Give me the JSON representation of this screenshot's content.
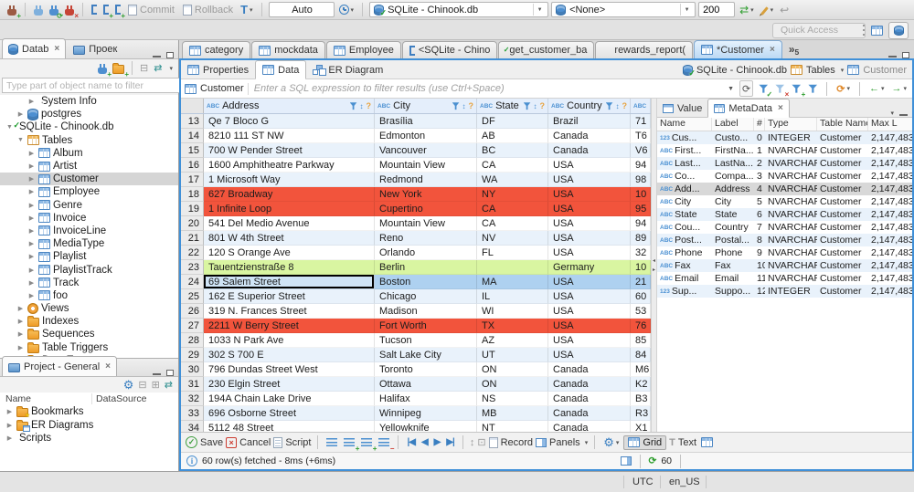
{
  "icons": {
    "caret": "▾",
    "dropdown": "▼",
    "close": "×",
    "check": "✓",
    "cross": "×",
    "refresh": "⟳",
    "gear": "⚙",
    "link": "⇄",
    "collapse": "⊟",
    "expand": "⊞",
    "plus": "+",
    "minus": "−",
    "back": "←",
    "forward": "→",
    "undo": "↩",
    "nav_first": "|◀",
    "nav_prev": "◀",
    "nav_next": "▶",
    "nav_last": "▶|",
    "overflow": "»",
    "info": "i",
    "sash_left": "◂",
    "sash_right": "▸",
    "tree_collapsed": "▶",
    "tree_expanded": "▼",
    "sort": "↕",
    "filter_help": "?",
    "txn": "T",
    "text_mode": "T",
    "type_string": "ABC",
    "type_int": "123",
    "swap": "↕",
    "preview": "⊡"
  },
  "toolbar": {
    "commit": "Commit",
    "rollback": "Rollback",
    "txn_mode": "T",
    "auto": "Auto",
    "connection": "SQLite - Chinook.db",
    "schema": "<None>",
    "fetch_size": "200",
    "quick_access": "Quick Access"
  },
  "navigator": {
    "tab_database": "Datab",
    "tab_project": "Проек",
    "filter_placeholder": "Type part of object name to filter",
    "tree": [
      {
        "label": "System Info",
        "icon": "folder-info",
        "indent": 2,
        "expanded": false
      },
      {
        "label": "postgres",
        "icon": "db",
        "indent": 1,
        "expanded": false
      },
      {
        "label": "SQLite - Chinook.db",
        "icon": "db-check",
        "indent": 0,
        "expanded": true
      },
      {
        "label": "Tables",
        "icon": "table-orange",
        "indent": 1,
        "expanded": true
      },
      {
        "label": "Album",
        "icon": "table",
        "indent": 2,
        "expanded": false
      },
      {
        "label": "Artist",
        "icon": "table",
        "indent": 2,
        "expanded": false
      },
      {
        "label": "Customer",
        "icon": "table",
        "indent": 2,
        "expanded": false,
        "selected": true
      },
      {
        "label": "Employee",
        "icon": "table",
        "indent": 2,
        "expanded": false
      },
      {
        "label": "Genre",
        "icon": "table",
        "indent": 2,
        "expanded": false
      },
      {
        "label": "Invoice",
        "icon": "table",
        "indent": 2,
        "expanded": false
      },
      {
        "label": "InvoiceLine",
        "icon": "table",
        "indent": 2,
        "expanded": false
      },
      {
        "label": "MediaType",
        "icon": "table",
        "indent": 2,
        "expanded": false
      },
      {
        "label": "Playlist",
        "icon": "table",
        "indent": 2,
        "expanded": false
      },
      {
        "label": "PlaylistTrack",
        "icon": "table",
        "indent": 2,
        "expanded": false
      },
      {
        "label": "Track",
        "icon": "table",
        "indent": 2,
        "expanded": false
      },
      {
        "label": "foo",
        "icon": "table",
        "indent": 2,
        "expanded": false
      },
      {
        "label": "Views",
        "icon": "eye",
        "indent": 1,
        "expanded": false
      },
      {
        "label": "Indexes",
        "icon": "folder",
        "indent": 1,
        "expanded": false
      },
      {
        "label": "Sequences",
        "icon": "folder",
        "indent": 1,
        "expanded": false
      },
      {
        "label": "Table Triggers",
        "icon": "folder",
        "indent": 1,
        "expanded": false
      },
      {
        "label": "Data Types",
        "icon": "folder",
        "indent": 1,
        "expanded": false
      }
    ]
  },
  "project": {
    "title": "Project - General",
    "columns": [
      "Name",
      "DataSource"
    ],
    "items": [
      {
        "label": "Bookmarks",
        "icon": "folder-star"
      },
      {
        "label": "ER Diagrams",
        "icon": "folder-er"
      },
      {
        "label": "Scripts",
        "icon": "scripts"
      }
    ]
  },
  "editor_tabs": [
    {
      "label": "category",
      "icon": "table",
      "active": false,
      "close": false
    },
    {
      "label": "mockdata",
      "icon": "table",
      "active": false,
      "close": false
    },
    {
      "label": "Employee",
      "icon": "table",
      "active": false,
      "close": false
    },
    {
      "label": "<SQLite - Chino",
      "icon": "bracket",
      "active": false,
      "close": false
    },
    {
      "label": "get_customer_ba",
      "icon": "script-check",
      "active": false,
      "close": false
    },
    {
      "label": "rewards_report(",
      "icon": "fx",
      "active": false,
      "close": false
    },
    {
      "label": "*Customer",
      "icon": "table",
      "active": true,
      "close": true
    }
  ],
  "tab_overflow": "5",
  "editor": {
    "subtabs": [
      "Properties",
      "Data",
      "ER Diagram"
    ],
    "breadcrumb": {
      "connection": "SQLite - Chinook.db",
      "container": "Tables",
      "entity": "Customer"
    },
    "filter_table": "Customer",
    "filter_placeholder": "Enter a SQL expression to filter results (use Ctrl+Space)"
  },
  "grid": {
    "columns": [
      "Address",
      "City",
      "State",
      "Country",
      ""
    ],
    "rows": [
      {
        "n": "13",
        "cells": [
          "Qe 7 Bloco G",
          "Brasília",
          "DF",
          "Brazil",
          "71"
        ]
      },
      {
        "n": "14",
        "cells": [
          "8210 111 ST NW",
          "Edmonton",
          "AB",
          "Canada",
          "T6"
        ]
      },
      {
        "n": "15",
        "cells": [
          "700 W Pender Street",
          "Vancouver",
          "BC",
          "Canada",
          "V6"
        ]
      },
      {
        "n": "16",
        "cells": [
          "1600 Amphitheatre Parkway",
          "Mountain View",
          "CA",
          "USA",
          "94"
        ]
      },
      {
        "n": "17",
        "cells": [
          "1 Microsoft Way",
          "Redmond",
          "WA",
          "USA",
          "98"
        ]
      },
      {
        "n": "18",
        "cells": [
          "627 Broadway",
          "New York",
          "NY",
          "USA",
          "10"
        ],
        "hl": "red"
      },
      {
        "n": "19",
        "cells": [
          "1 Infinite Loop",
          "Cupertino",
          "CA",
          "USA",
          "95"
        ],
        "hl": "red"
      },
      {
        "n": "20",
        "cells": [
          "541 Del Medio Avenue",
          "Mountain View",
          "CA",
          "USA",
          "94"
        ]
      },
      {
        "n": "21",
        "cells": [
          "801 W 4th Street",
          "Reno",
          "NV",
          "USA",
          "89"
        ]
      },
      {
        "n": "22",
        "cells": [
          "120 S Orange Ave",
          "Orlando",
          "FL",
          "USA",
          "32"
        ]
      },
      {
        "n": "23",
        "cells": [
          "Tauentzienstraße 8",
          "Berlin",
          "",
          "Germany",
          "10"
        ],
        "hl": "green"
      },
      {
        "n": "24",
        "cells": [
          "69 Salem Street",
          "Boston",
          "MA",
          "USA",
          "21"
        ],
        "hl": "sel",
        "focus": 0
      },
      {
        "n": "25",
        "cells": [
          "162 E Superior Street",
          "Chicago",
          "IL",
          "USA",
          "60"
        ]
      },
      {
        "n": "26",
        "cells": [
          "319 N. Frances Street",
          "Madison",
          "WI",
          "USA",
          "53"
        ]
      },
      {
        "n": "27",
        "cells": [
          "2211 W Berry Street",
          "Fort Worth",
          "TX",
          "USA",
          "76"
        ],
        "hl": "red"
      },
      {
        "n": "28",
        "cells": [
          "1033 N Park Ave",
          "Tucson",
          "AZ",
          "USA",
          "85"
        ]
      },
      {
        "n": "29",
        "cells": [
          "302 S 700 E",
          "Salt Lake City",
          "UT",
          "USA",
          "84"
        ]
      },
      {
        "n": "30",
        "cells": [
          "796 Dundas Street West",
          "Toronto",
          "ON",
          "Canada",
          "M6"
        ]
      },
      {
        "n": "31",
        "cells": [
          "230 Elgin Street",
          "Ottawa",
          "ON",
          "Canada",
          "K2"
        ]
      },
      {
        "n": "32",
        "cells": [
          "194A Chain Lake Drive",
          "Halifax",
          "NS",
          "Canada",
          "B3"
        ]
      },
      {
        "n": "33",
        "cells": [
          "696 Osborne Street",
          "Winnipeg",
          "MB",
          "Canada",
          "R3"
        ]
      },
      {
        "n": "34",
        "cells": [
          "5112 48 Street",
          "Yellowknife",
          "NT",
          "Canada",
          "X1"
        ]
      }
    ]
  },
  "meta": {
    "tab_value": "Value",
    "tab_metadata": "MetaData",
    "columns": [
      "Name",
      "Label",
      "#",
      "Type",
      "Table Name",
      "Max L"
    ],
    "rows": [
      {
        "t": "123",
        "name": "Cus...",
        "label": "Custo...",
        "num": "0",
        "type": "INTEGER",
        "table": "Customer",
        "max": "2,147,483"
      },
      {
        "t": "abc",
        "name": "First...",
        "label": "FirstNa...",
        "num": "1",
        "type": "NVARCHAR",
        "table": "Customer",
        "max": "2,147,483"
      },
      {
        "t": "abc",
        "name": "Last...",
        "label": "LastNa...",
        "num": "2",
        "type": "NVARCHAR",
        "table": "Customer",
        "max": "2,147,483"
      },
      {
        "t": "abc",
        "name": "Co...",
        "label": "Compa...",
        "num": "3",
        "type": "NVARCHAR",
        "table": "Customer",
        "max": "2,147,483"
      },
      {
        "t": "abc",
        "name": "Add...",
        "label": "Address",
        "num": "4",
        "type": "NVARCHAR",
        "table": "Customer",
        "max": "2,147,483",
        "sel": true
      },
      {
        "t": "abc",
        "name": "City",
        "label": "City",
        "num": "5",
        "type": "NVARCHAR",
        "table": "Customer",
        "max": "2,147,483"
      },
      {
        "t": "abc",
        "name": "State",
        "label": "State",
        "num": "6",
        "type": "NVARCHAR",
        "table": "Customer",
        "max": "2,147,483"
      },
      {
        "t": "abc",
        "name": "Cou...",
        "label": "Country",
        "num": "7",
        "type": "NVARCHAR",
        "table": "Customer",
        "max": "2,147,483"
      },
      {
        "t": "abc",
        "name": "Post...",
        "label": "Postal...",
        "num": "8",
        "type": "NVARCHAR",
        "table": "Customer",
        "max": "2,147,483"
      },
      {
        "t": "abc",
        "name": "Phone",
        "label": "Phone",
        "num": "9",
        "type": "NVARCHAR",
        "table": "Customer",
        "max": "2,147,483"
      },
      {
        "t": "abc",
        "name": "Fax",
        "label": "Fax",
        "num": "10",
        "type": "NVARCHAR",
        "table": "Customer",
        "max": "2,147,483"
      },
      {
        "t": "abc",
        "name": "Email",
        "label": "Email",
        "num": "11",
        "type": "NVARCHAR",
        "table": "Customer",
        "max": "2,147,483"
      },
      {
        "t": "123",
        "name": "Sup...",
        "label": "Suppo...",
        "num": "12",
        "type": "INTEGER",
        "table": "Customer",
        "max": "2,147,483"
      }
    ]
  },
  "result_toolbar": {
    "save": "Save",
    "cancel": "Cancel",
    "script": "Script",
    "record": "Record",
    "panels": "Panels",
    "grid": "Grid",
    "text": "Text"
  },
  "status": {
    "message": "60 row(s) fetched - 8ms (+6ms)",
    "count": "60"
  },
  "statusbar": {
    "tz": "UTC",
    "locale": "en_US"
  },
  "colors": {
    "accent": "#3f8fd4",
    "row_red": "#f2543c",
    "row_green": "#d9f5a1",
    "row_selected": "#aed1f0",
    "row_alt": "#e9f2fb",
    "header_bg": "#e4eefb"
  }
}
